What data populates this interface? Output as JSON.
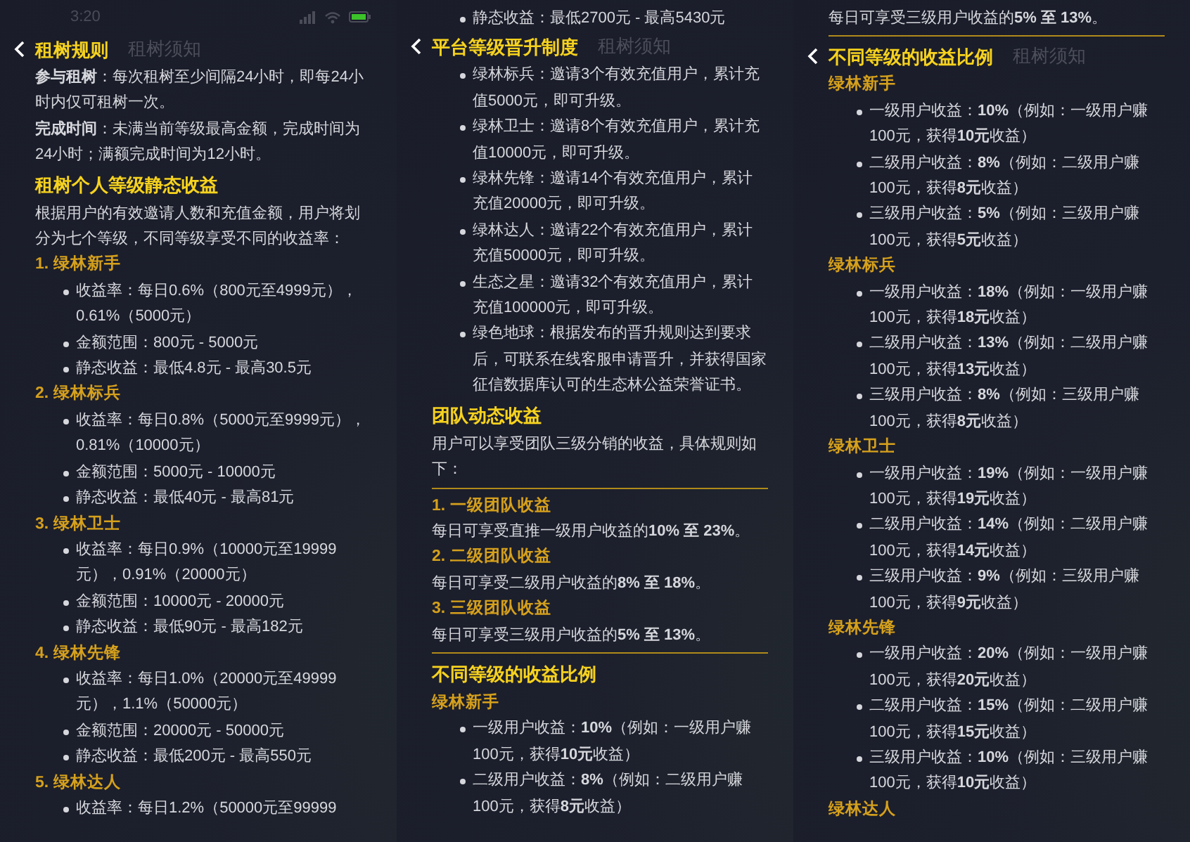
{
  "panels": [
    {
      "status": {
        "time": "3:20"
      },
      "header": {
        "heading": "租树规则",
        "title": "租树须知"
      },
      "blocks": [
        {
          "kind": "para",
          "text": "**参与租树**：每次租树至少间隔24小时，即每24小时内仅可租树一次。"
        },
        {
          "kind": "para",
          "text": "**完成时间**：未满当前等级最高金额，完成时间为24小时；满额完成时间为12小时。"
        },
        {
          "kind": "heading",
          "text": "租树个人等级静态收益"
        },
        {
          "kind": "para",
          "text": "根据用户的有效邀请人数和充值金额，用户将划分为七个等级，不同等级享受不同的收益率："
        },
        {
          "kind": "sub",
          "text": "1. 绿林新手"
        },
        {
          "kind": "bullets",
          "items": [
            "收益率：每日0.6%（800元至4999元），0.61%（5000元）",
            "金额范围：800元 - 5000元",
            "静态收益：最低4.8元 - 最高30.5元"
          ]
        },
        {
          "kind": "sub",
          "text": "2. 绿林标兵"
        },
        {
          "kind": "bullets",
          "items": [
            "收益率：每日0.8%（5000元至9999元），0.81%（10000元）",
            "金额范围：5000元 - 10000元",
            "静态收益：最低40元 - 最高81元"
          ]
        },
        {
          "kind": "sub",
          "text": "3. 绿林卫士"
        },
        {
          "kind": "bullets",
          "items": [
            "收益率：每日0.9%（10000元至19999元），0.91%（20000元）",
            "金额范围：10000元 - 20000元",
            "静态收益：最低90元 - 最高182元"
          ]
        },
        {
          "kind": "sub",
          "text": "4. 绿林先锋"
        },
        {
          "kind": "bullets",
          "items": [
            "收益率：每日1.0%（20000元至49999元），1.1%（50000元）",
            "金额范围：20000元 - 50000元",
            "静态收益：最低200元 - 最高550元"
          ]
        },
        {
          "kind": "sub",
          "text": "5. 绿林达人"
        },
        {
          "kind": "bullets",
          "items": [
            "收益率：每日1.2%（50000元至99999"
          ]
        }
      ]
    },
    {
      "top": [
        {
          "kind": "bullets",
          "items": [
            "静态收益：最低2700元 - 最高5430元"
          ]
        }
      ],
      "header": {
        "heading": "平台等级晋升制度",
        "title": "租树须知"
      },
      "blocks": [
        {
          "kind": "bullets",
          "items": [
            "绿林标兵：邀请3个有效充值用户，累计充值5000元，即可升级。",
            "绿林卫士：邀请8个有效充值用户，累计充值10000元，即可升级。",
            "绿林先锋：邀请14个有效充值用户，累计充值20000元，即可升级。",
            "绿林达人：邀请22个有效充值用户，累计充值50000元，即可升级。",
            "生态之星：邀请32个有效充值用户，累计充值100000元，即可升级。",
            "绿色地球：根据发布的晋升规则达到要求后，可联系在线客服申请晋升，并获得国家征信数据库认可的生态林公益荣誉证书。"
          ]
        },
        {
          "kind": "heading",
          "text": "团队动态收益"
        },
        {
          "kind": "para",
          "text": "用户可以享受团队三级分销的收益，具体规则如下："
        },
        {
          "kind": "rule"
        },
        {
          "kind": "sub",
          "text": "1. 一级团队收益"
        },
        {
          "kind": "para",
          "text": "每日可享受直推一级用户收益的**10% 至 23%**。"
        },
        {
          "kind": "sub",
          "text": "2. 二级团队收益"
        },
        {
          "kind": "para",
          "text": "每日可享受二级用户收益的**8% 至 18%**。"
        },
        {
          "kind": "sub",
          "text": "3. 三级团队收益"
        },
        {
          "kind": "para",
          "text": "每日可享受三级用户收益的**5% 至 13%**。"
        },
        {
          "kind": "rule"
        },
        {
          "kind": "heading",
          "text": "不同等级的收益比例"
        },
        {
          "kind": "sub",
          "text": "绿林新手"
        },
        {
          "kind": "bullets",
          "items": [
            "一级用户收益：**10%**（例如：一级用户赚100元，获得**10元**收益）",
            "二级用户收益：**8%**（例如：二级用户赚100元，获得**8元**收益）"
          ]
        }
      ]
    },
    {
      "top": [
        {
          "kind": "para",
          "text": "每日可享受三级用户收益的**5% 至 13%**。"
        },
        {
          "kind": "rule"
        }
      ],
      "header": {
        "heading": "不同等级的收益比例",
        "title": "租树须知"
      },
      "blocks": [
        {
          "kind": "sub",
          "text": "绿林新手"
        },
        {
          "kind": "bullets",
          "items": [
            "一级用户收益：**10%**（例如：一级用户赚100元，获得**10元**收益）",
            "二级用户收益：**8%**（例如：二级用户赚100元，获得**8元**收益）",
            "三级用户收益：**5%**（例如：三级用户赚100元，获得**5元**收益）"
          ]
        },
        {
          "kind": "sub",
          "text": "绿林标兵"
        },
        {
          "kind": "bullets",
          "items": [
            "一级用户收益：**18%**（例如：一级用户赚100元，获得**18元**收益）",
            "二级用户收益：**13%**（例如：二级用户赚100元，获得**13元**收益）",
            "三级用户收益：**8%**（例如：三级用户赚100元，获得**8元**收益）"
          ]
        },
        {
          "kind": "sub",
          "text": "绿林卫士"
        },
        {
          "kind": "bullets",
          "items": [
            "一级用户收益：**19%**（例如：一级用户赚100元，获得**19元**收益）",
            "二级用户收益：**14%**（例如：二级用户赚100元，获得**14元**收益）",
            "三级用户收益：**9%**（例如：三级用户赚100元，获得**9元**收益）"
          ]
        },
        {
          "kind": "sub",
          "text": "绿林先锋"
        },
        {
          "kind": "bullets",
          "items": [
            "一级用户收益：**20%**（例如：一级用户赚100元，获得**20元**收益）",
            "二级用户收益：**15%**（例如：二级用户赚100元，获得**15元**收益）",
            "三级用户收益：**10%**（例如：三级用户赚100元，获得**10元**收益）"
          ]
        },
        {
          "kind": "sub",
          "text": "绿林达人"
        }
      ]
    }
  ]
}
